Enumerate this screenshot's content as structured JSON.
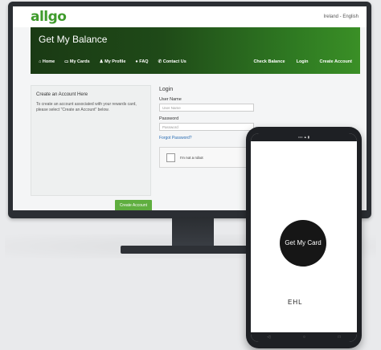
{
  "brand": {
    "logo": "allgo",
    "accent": "#3f9b2c"
  },
  "header": {
    "language": "Ireland - English"
  },
  "banner": {
    "title": "Get My Balance"
  },
  "nav": {
    "left": [
      "Home",
      "My Cards",
      "My Profile",
      "FAQ",
      "Contact Us"
    ],
    "right": [
      "Check Balance",
      "Login",
      "Create Account"
    ]
  },
  "create_account": {
    "heading": "Create an Account Here",
    "text": "To create an account associated with your rewards card, please select \"Create an Account\" below.",
    "button": "Create Account"
  },
  "login": {
    "title": "Login",
    "username_label": "User Name",
    "username_placeholder": "User Name",
    "password_label": "Password",
    "password_placeholder": "Password",
    "forgot": "Forgot Password?",
    "captcha": "I'm not a robot"
  },
  "phone": {
    "app_text": "Get My Card",
    "brand": "EHL"
  }
}
